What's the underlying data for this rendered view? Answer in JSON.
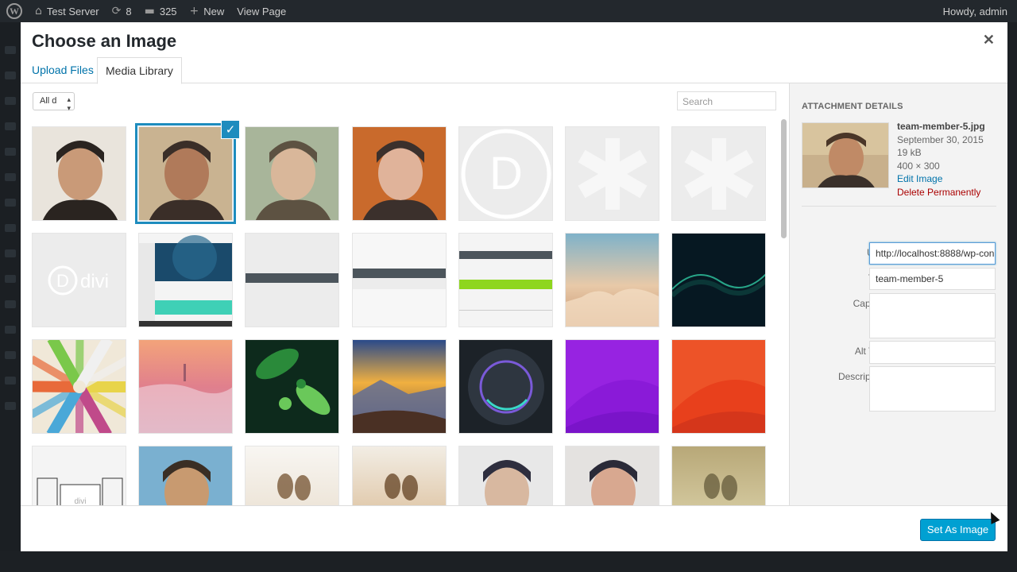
{
  "adminbar": {
    "site_name": "Test Server",
    "updates_count": "8",
    "comments_count": "325",
    "new_label": "New",
    "view_page_label": "View Page",
    "howdy": "Howdy, admin"
  },
  "modal": {
    "title": "Choose an Image",
    "tabs": [
      "Upload Files",
      "Media Library"
    ],
    "filter_value": "All d",
    "search_placeholder": "Search",
    "selected_index": 1
  },
  "sidebar": {
    "heading": "ATTACHMENT DETAILS",
    "filename": "team-member-5.jpg",
    "date": "September 30, 2015",
    "size": "19 kB",
    "dimensions": "400 × 300",
    "edit_label": "Edit Image",
    "delete_label": "Delete Permanently",
    "fields": {
      "url_label": "URL",
      "url_value": "http://localhost:8888/wp-con",
      "title_label": "Title",
      "title_value": "team-member-5",
      "caption_label": "Caption",
      "alt_label": "Alt Text",
      "description_label": "Description"
    }
  },
  "footer": {
    "button_label": "Set As Image"
  },
  "grid_items": [
    {
      "name": "thumb-man-glasses",
      "colors": [
        "#e9e4dc",
        "#c99a78",
        "#2a2420"
      ],
      "kind": "portrait"
    },
    {
      "name": "thumb-team-member-5",
      "colors": [
        "#c9b391",
        "#b07a5a",
        "#3a2e28"
      ],
      "kind": "portrait"
    },
    {
      "name": "thumb-woman-smiling",
      "colors": [
        "#a8b59a",
        "#d9b79a",
        "#5d5242"
      ],
      "kind": "portrait"
    },
    {
      "name": "thumb-woman-beanie",
      "colors": [
        "#c96a2c",
        "#e0b39a",
        "#3b302c"
      ],
      "kind": "portrait"
    },
    {
      "name": "thumb-divi-logo",
      "colors": [
        "#ececec",
        "#ffffff",
        "#dddddd"
      ],
      "kind": "divi-d"
    },
    {
      "name": "thumb-placeholder-1",
      "colors": [
        "#ececec",
        "#f7f7f7",
        "#e0e0e0"
      ],
      "kind": "placeholder"
    },
    {
      "name": "thumb-placeholder-2",
      "colors": [
        "#ececec",
        "#f7f7f7",
        "#e0e0e0"
      ],
      "kind": "placeholder"
    },
    {
      "name": "thumb-divi-text",
      "colors": [
        "#ececec",
        "#ffffff",
        "#dddddd"
      ],
      "kind": "divi-text"
    },
    {
      "name": "thumb-website-screenshot",
      "colors": [
        "#1a4a6b",
        "#3fd0b6",
        "#f4f4f4"
      ],
      "kind": "screenshot"
    },
    {
      "name": "thumb-layout-1",
      "colors": [
        "#ececec",
        "#4c555c",
        "#f7f7f7"
      ],
      "kind": "layout"
    },
    {
      "name": "thumb-layout-2",
      "colors": [
        "#ececec",
        "#4c555c",
        "#f7f7f7"
      ],
      "kind": "layout2"
    },
    {
      "name": "thumb-layout-green",
      "colors": [
        "#f4f4f4",
        "#4c555c",
        "#8ed61e"
      ],
      "kind": "layout3"
    },
    {
      "name": "thumb-clouds-sky",
      "colors": [
        "#7fb2c9",
        "#e8c9a8",
        "#c7956f"
      ],
      "kind": "sky"
    },
    {
      "name": "thumb-green-waves",
      "colors": [
        "#061822",
        "#0c3b3a",
        "#2fc9a2"
      ],
      "kind": "dark"
    },
    {
      "name": "thumb-color-pencils",
      "colors": [
        "#e8d44a",
        "#c04a8a",
        "#4aa8d8"
      ],
      "kind": "pencils"
    },
    {
      "name": "thumb-city-fog",
      "colors": [
        "#f3a37a",
        "#e07f8d",
        "#c79bb5"
      ],
      "kind": "fog"
    },
    {
      "name": "thumb-leaves",
      "colors": [
        "#0d2a1c",
        "#2a8a3a",
        "#6ac85a"
      ],
      "kind": "leaves"
    },
    {
      "name": "thumb-mountain-sunset",
      "colors": [
        "#2a4a8a",
        "#f0b040",
        "#6a4a3a"
      ],
      "kind": "mountain"
    },
    {
      "name": "thumb-circle-ring",
      "colors": [
        "#1c2228",
        "#2e3640",
        "#7a5ad8"
      ],
      "kind": "ring"
    },
    {
      "name": "thumb-purple",
      "colors": [
        "#8a1ad8",
        "#a02ae8",
        "#7010c0"
      ],
      "kind": "flat"
    },
    {
      "name": "thumb-red-orange",
      "colors": [
        "#e8401c",
        "#f06030",
        "#c8301a"
      ],
      "kind": "flat"
    },
    {
      "name": "thumb-divi-wireframe",
      "colors": [
        "#f4f4f4",
        "#dddddd",
        "#333333"
      ],
      "kind": "wire"
    },
    {
      "name": "thumb-couple-selfie",
      "colors": [
        "#7ab0d0",
        "#c89a70",
        "#3a2e24"
      ],
      "kind": "portrait"
    },
    {
      "name": "thumb-legs-jumping",
      "colors": [
        "#f8f6f2",
        "#e8dccb",
        "#7a5a3a"
      ],
      "kind": "soft"
    },
    {
      "name": "thumb-boots",
      "colors": [
        "#f2ede4",
        "#d8b890",
        "#6a4a2a"
      ],
      "kind": "soft"
    },
    {
      "name": "thumb-woman-hat-1",
      "colors": [
        "#e8e8e8",
        "#d8b8a0",
        "#2e2e3e"
      ],
      "kind": "portrait"
    },
    {
      "name": "thumb-woman-hat-2",
      "colors": [
        "#e4e2e0",
        "#d8a890",
        "#2a2a38"
      ],
      "kind": "portrait"
    },
    {
      "name": "thumb-alley",
      "colors": [
        "#b8a878",
        "#e0d8b0",
        "#6a6040"
      ],
      "kind": "soft"
    }
  ]
}
